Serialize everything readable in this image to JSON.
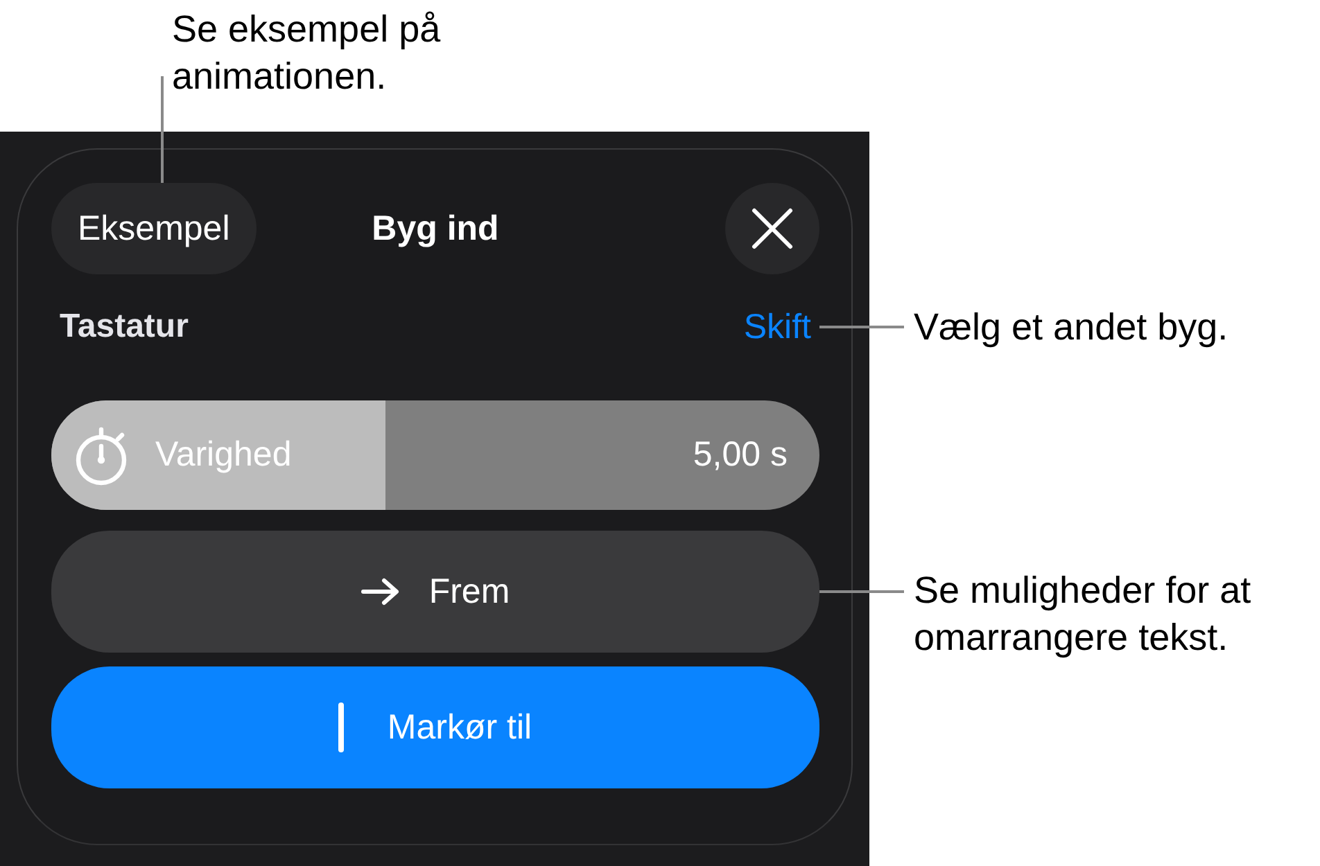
{
  "callouts": [
    {
      "text": "Se eksempel på animationen."
    },
    {
      "text": "Vælg et andet byg."
    },
    {
      "text": "Se muligheder for at omarrangere tekst."
    }
  ],
  "sheet": {
    "header": {
      "preview_button": "Eksempel",
      "title": "Byg ind"
    },
    "build": {
      "label": "Tastatur",
      "change_link": "Skift"
    },
    "duration": {
      "label": "Varighed",
      "reading": "5,00 s",
      "level": 0.435
    },
    "options": [
      {
        "kind": "arrow",
        "label": "Frem",
        "selected": false
      },
      {
        "kind": "cursor",
        "label": "Markør til",
        "selected": true
      }
    ]
  }
}
